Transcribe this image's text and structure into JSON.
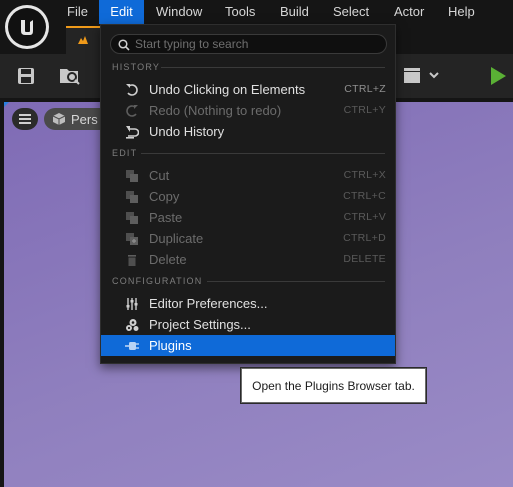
{
  "menubar": {
    "items": [
      {
        "label": "File"
      },
      {
        "label": "Edit"
      },
      {
        "label": "Window"
      },
      {
        "label": "Tools"
      },
      {
        "label": "Build"
      },
      {
        "label": "Select"
      },
      {
        "label": "Actor"
      },
      {
        "label": "Help"
      }
    ],
    "active": "Edit"
  },
  "viewport": {
    "perspective_label": "Pers"
  },
  "edit_menu": {
    "search": {
      "placeholder": "Start typing to search",
      "value": ""
    },
    "sections": [
      {
        "header": "HISTORY",
        "items": [
          {
            "label": "Undo Clicking on Elements",
            "shortcut": "CTRL+Z",
            "icon": "undo-icon",
            "enabled": true
          },
          {
            "label": "Redo (Nothing to redo)",
            "shortcut": "CTRL+Y",
            "icon": "redo-icon",
            "enabled": false
          },
          {
            "label": "Undo History",
            "shortcut": "",
            "icon": "undo-history-icon",
            "enabled": true
          }
        ]
      },
      {
        "header": "EDIT",
        "items": [
          {
            "label": "Cut",
            "shortcut": "CTRL+X",
            "icon": "cut-icon",
            "enabled": false
          },
          {
            "label": "Copy",
            "shortcut": "CTRL+C",
            "icon": "copy-icon",
            "enabled": false
          },
          {
            "label": "Paste",
            "shortcut": "CTRL+V",
            "icon": "paste-icon",
            "enabled": false
          },
          {
            "label": "Duplicate",
            "shortcut": "CTRL+D",
            "icon": "duplicate-icon",
            "enabled": false
          },
          {
            "label": "Delete",
            "shortcut": "DELETE",
            "icon": "delete-icon",
            "enabled": false
          }
        ]
      },
      {
        "header": "CONFIGURATION",
        "items": [
          {
            "label": "Editor Preferences...",
            "shortcut": "",
            "icon": "sliders-icon",
            "enabled": true
          },
          {
            "label": "Project Settings...",
            "shortcut": "",
            "icon": "gears-icon",
            "enabled": true
          },
          {
            "label": "Plugins",
            "shortcut": "",
            "icon": "plug-icon",
            "enabled": true,
            "highlighted": true
          }
        ]
      }
    ]
  },
  "tooltip": {
    "text": "Open the Plugins Browser tab."
  },
  "colors": {
    "accent": "#0f6ad8",
    "play_green": "#5ab035",
    "tab_orange": "#ef9a1a",
    "viewport_purple": "#8f7fbe"
  }
}
